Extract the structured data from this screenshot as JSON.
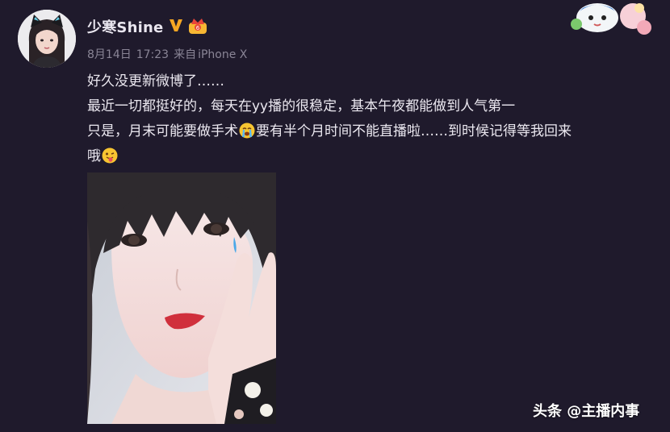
{
  "post": {
    "username": "少寒Shine",
    "date": "8月14日",
    "time": "17:23",
    "source_prefix": "来自",
    "source": "iPhone X",
    "lines": [
      "好久没更新微博了……",
      "最近一切都挺好的，每天在yy播的很稳定，基本午夜都能做到人气第一",
      "只是，月末可能要做手术",
      "要有半个月时间不能直播啦……到时候记得等我回来",
      "哦"
    ]
  },
  "badges": {
    "verified_icon": "v-badge-icon",
    "member_icon": "crown-member-icon"
  },
  "icons": {
    "crying_emoji": "crying-face-emoji",
    "tongue_emoji": "tongue-out-face-emoji"
  },
  "watermark": {
    "text": "头条 @主播内事"
  },
  "colors": {
    "background": "#1f1a2c",
    "text": "#ebe8f0",
    "meta": "#8a8596",
    "verified": "#f5a623"
  }
}
